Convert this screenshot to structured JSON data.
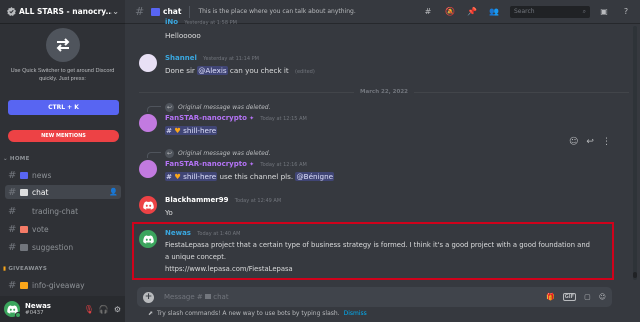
{
  "server": {
    "name": "ALL STARS - nanocry...",
    "verified": true
  },
  "quick_switcher": {
    "text": "Use Quick Switcher to get around Discord quickly. Just press:",
    "shortcut": "CTRL + K"
  },
  "new_mentions_label": "NEW MENTIONS",
  "categories": {
    "home": "HOME",
    "giveaways": "GIVEAWAYS"
  },
  "channels": [
    {
      "name": "news",
      "emoji_color": "#5865f2",
      "active": false
    },
    {
      "name": "chat",
      "emoji_color": "#dcddde",
      "active": true
    },
    {
      "name": "trading-chat",
      "emoji_color": "",
      "active": false
    },
    {
      "name": "vote",
      "emoji_color": "#f47b67",
      "active": false
    },
    {
      "name": "suggestion",
      "emoji_color": "#72767d",
      "active": false
    },
    {
      "name": "info-giveaway",
      "emoji_color": "#faa61a",
      "active": false
    }
  ],
  "user": {
    "name": "Newas",
    "tag": "#0437"
  },
  "topbar": {
    "channel": "chat",
    "topic": "This is the place where you can talk about anything.",
    "search_placeholder": "Search"
  },
  "messages": {
    "partial": {
      "author": "iNo",
      "time": "Yesterday at 1:58 PM",
      "text": "Hellooooo"
    },
    "m1": {
      "author": "Shannel",
      "time": "Yesterday at 11:14 PM",
      "pre": "Done sir ",
      "mention": "@Alexis",
      "post": " can you check it",
      "edited": "(edited)"
    },
    "date_divider": "March 22, 2022",
    "m2": {
      "reply_note": "Original message was deleted.",
      "author": "FanSTAR-nanocrypto",
      "time": "Today at 12:15 AM",
      "prefix": "#",
      "mention": "shill-here"
    },
    "m3": {
      "reply_note": "Original message was deleted.",
      "author": "FanSTAR-nanocrypto",
      "time": "Today at 12:16 AM",
      "prefix": "#",
      "mention": "shill-here",
      "post": " use this channel pls. ",
      "mention2": "@Bénigne"
    },
    "m4": {
      "author": "Blackhammer99",
      "time": "Today at 12:49 AM",
      "text": "Yo"
    },
    "m5": {
      "author": "Newas",
      "time": "Today at 1:40 AM",
      "line1": "FiestaLepasa project that a certain type of business strategy is formed. I think it's a good project with a good foundation and",
      "line2": "a unique concept.",
      "link": "https://www.lepasa.com/FiestaLepasa"
    }
  },
  "composer": {
    "placeholder": "Message #",
    "channel": "chat"
  },
  "slash_tip": {
    "text": "Try slash commands! A new way to use bots by typing slash.",
    "dismiss": "Dismiss"
  },
  "colors": {
    "accent": "#5865f2",
    "danger": "#ed4245",
    "fanstar": "#b473f5",
    "blue_author": "#3aa8e0",
    "highlight_box": "#d0021b"
  }
}
